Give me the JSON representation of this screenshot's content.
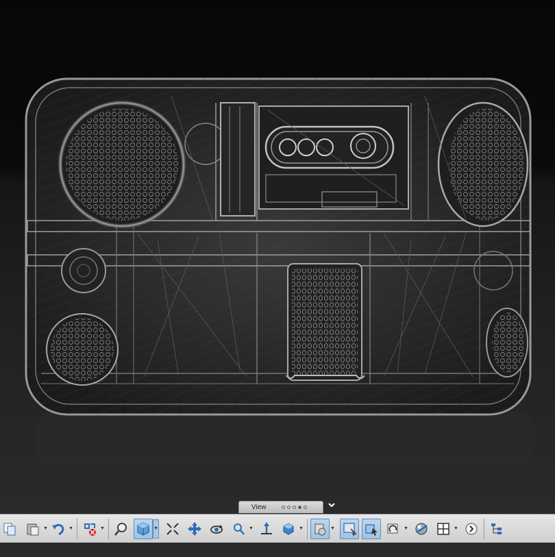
{
  "viewport": {
    "model": "boombox-wireframe",
    "background": "#0a0a0a",
    "floor": "#262626"
  },
  "view_tab": {
    "label": "View",
    "dots": 5,
    "active_dot": 4
  },
  "toolbar": {
    "buttons": [
      {
        "name": "copy-button",
        "icon": "copy-icon"
      },
      {
        "name": "paste-button",
        "icon": "paste-icon",
        "dropdown": true
      },
      {
        "name": "undo-button",
        "icon": "undo-icon",
        "dropdown": true
      },
      {
        "name": "select-filter-button",
        "icon": "select-filter-icon",
        "dropdown": true
      },
      {
        "name": "zoom-window-button",
        "icon": "zoom-window-icon"
      },
      {
        "name": "display-mode-button",
        "icon": "cube-icon",
        "active": true,
        "dropdown": true
      },
      {
        "name": "fit-all-button",
        "icon": "fit-all-icon"
      },
      {
        "name": "pan-button",
        "icon": "pan-icon"
      },
      {
        "name": "orbit-button",
        "icon": "orbit-icon"
      },
      {
        "name": "zoom-button",
        "icon": "zoom-icon",
        "dropdown": true
      },
      {
        "name": "normal-to-button",
        "icon": "axis-icon"
      },
      {
        "name": "view-orientation-button",
        "icon": "view-cube-icon",
        "dropdown": true
      },
      {
        "name": "section-button",
        "icon": "section-icon",
        "active": true,
        "dropdown": true
      },
      {
        "name": "render-button",
        "icon": "render-icon",
        "active": true
      },
      {
        "name": "select-through-button",
        "icon": "select-through-icon",
        "active": true
      },
      {
        "name": "refresh-view-button",
        "icon": "refresh-view-icon",
        "dropdown": true
      },
      {
        "name": "appearance-button",
        "icon": "appearance-icon"
      },
      {
        "name": "layout-button",
        "icon": "layout-icon",
        "dropdown": true
      },
      {
        "name": "more-button",
        "icon": "chevron-right-icon"
      },
      {
        "name": "tree-button",
        "icon": "tree-icon"
      }
    ]
  }
}
